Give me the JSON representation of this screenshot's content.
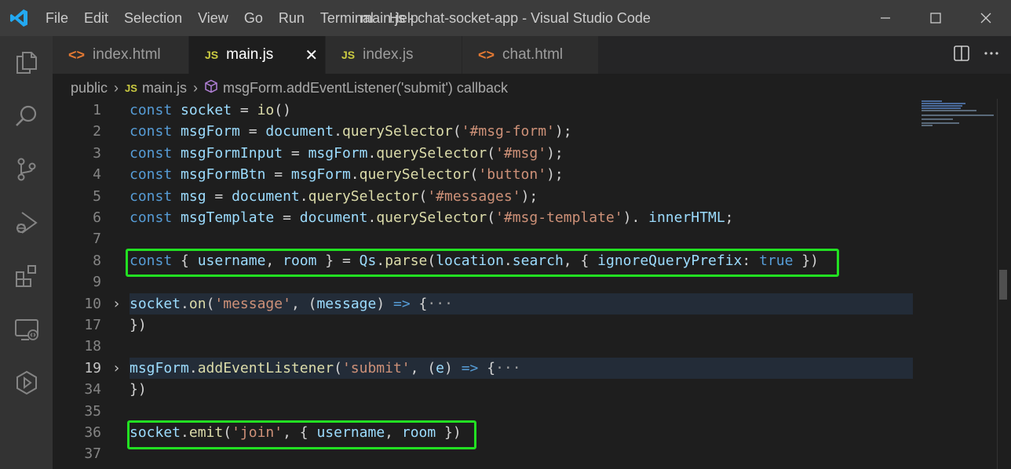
{
  "window": {
    "title": "main.js - chat-socket-app - Visual Studio Code",
    "menu": [
      "File",
      "Edit",
      "Selection",
      "View",
      "Go",
      "Run",
      "Terminal",
      "Help"
    ]
  },
  "activity_bar": [
    "explorer-icon",
    "search-icon",
    "source-control-icon",
    "run-debug-icon",
    "extensions-icon",
    "remote-explorer-icon",
    "live-share-icon"
  ],
  "tabs": [
    {
      "label": "index.html",
      "icon": "<>",
      "type": "html",
      "active": false
    },
    {
      "label": "main.js",
      "icon": "JS",
      "type": "js",
      "active": true,
      "close": "✕"
    },
    {
      "label": "index.js",
      "icon": "JS",
      "type": "js",
      "active": false
    },
    {
      "label": "chat.html",
      "icon": "<>",
      "type": "html",
      "active": false
    }
  ],
  "breadcrumb": {
    "folder": "public",
    "file_icon": "JS",
    "file": "main.js",
    "symbol": "msgForm.addEventListener('submit') callback"
  },
  "editor": {
    "lines": [
      {
        "n": "1",
        "tokens": [
          [
            "k",
            "const "
          ],
          [
            "v",
            "socket"
          ],
          [
            "p",
            " = "
          ],
          [
            "f",
            "io"
          ],
          [
            "p",
            "()"
          ]
        ]
      },
      {
        "n": "2",
        "tokens": [
          [
            "k",
            "const "
          ],
          [
            "v",
            "msgForm"
          ],
          [
            "p",
            " = "
          ],
          [
            "v",
            "document"
          ],
          [
            "p",
            "."
          ],
          [
            "f",
            "querySelector"
          ],
          [
            "p",
            "("
          ],
          [
            "s",
            "'#msg-form'"
          ],
          [
            "p",
            ");"
          ]
        ]
      },
      {
        "n": "3",
        "tokens": [
          [
            "k",
            "const "
          ],
          [
            "v",
            "msgFormInput"
          ],
          [
            "p",
            " = "
          ],
          [
            "v",
            "msgForm"
          ],
          [
            "p",
            "."
          ],
          [
            "f",
            "querySelector"
          ],
          [
            "p",
            "("
          ],
          [
            "s",
            "'#msg'"
          ],
          [
            "p",
            ");"
          ]
        ]
      },
      {
        "n": "4",
        "tokens": [
          [
            "k",
            "const "
          ],
          [
            "v",
            "msgFormBtn"
          ],
          [
            "p",
            " = "
          ],
          [
            "v",
            "msgForm"
          ],
          [
            "p",
            "."
          ],
          [
            "f",
            "querySelector"
          ],
          [
            "p",
            "("
          ],
          [
            "s",
            "'button'"
          ],
          [
            "p",
            ");"
          ]
        ]
      },
      {
        "n": "5",
        "tokens": [
          [
            "k",
            "const "
          ],
          [
            "v",
            "msg"
          ],
          [
            "p",
            " = "
          ],
          [
            "v",
            "document"
          ],
          [
            "p",
            "."
          ],
          [
            "f",
            "querySelector"
          ],
          [
            "p",
            "("
          ],
          [
            "s",
            "'#messages'"
          ],
          [
            "p",
            ");"
          ]
        ]
      },
      {
        "n": "6",
        "tokens": [
          [
            "k",
            "const "
          ],
          [
            "v",
            "msgTemplate"
          ],
          [
            "p",
            " = "
          ],
          [
            "v",
            "document"
          ],
          [
            "p",
            "."
          ],
          [
            "f",
            "querySelector"
          ],
          [
            "p",
            "("
          ],
          [
            "s",
            "'#msg-template'"
          ],
          [
            "p",
            "). "
          ],
          [
            "v",
            "innerHTML"
          ],
          [
            "p",
            ";"
          ]
        ]
      },
      {
        "n": "7",
        "tokens": []
      },
      {
        "n": "8",
        "tokens": [
          [
            "k",
            "const "
          ],
          [
            "p",
            "{ "
          ],
          [
            "v",
            "username"
          ],
          [
            "p",
            ", "
          ],
          [
            "v",
            "room"
          ],
          [
            "p",
            " } = "
          ],
          [
            "v",
            "Qs"
          ],
          [
            "p",
            "."
          ],
          [
            "f",
            "parse"
          ],
          [
            "p",
            "("
          ],
          [
            "v",
            "location"
          ],
          [
            "p",
            "."
          ],
          [
            "v",
            "search"
          ],
          [
            "p",
            ", { "
          ],
          [
            "v",
            "ignoreQueryPrefix"
          ],
          [
            "p",
            ": "
          ],
          [
            "k",
            "true"
          ],
          [
            "p",
            " })"
          ]
        ]
      },
      {
        "n": "9",
        "tokens": []
      },
      {
        "n": "10",
        "fold": true,
        "tokens": [
          [
            "v",
            "socket"
          ],
          [
            "p",
            "."
          ],
          [
            "f",
            "on"
          ],
          [
            "p",
            "("
          ],
          [
            "s",
            "'message'"
          ],
          [
            "p",
            ", ("
          ],
          [
            "v",
            "message"
          ],
          [
            "p",
            ") "
          ],
          [
            "k",
            "=>"
          ],
          [
            "p",
            " {"
          ],
          [
            "ell",
            "···"
          ]
        ]
      },
      {
        "n": "17",
        "tokens": [
          [
            "p",
            "})"
          ]
        ]
      },
      {
        "n": "18",
        "tokens": []
      },
      {
        "n": "19",
        "fold": true,
        "current": true,
        "tokens": [
          [
            "v",
            "msgForm"
          ],
          [
            "p",
            "."
          ],
          [
            "f",
            "addEventListener"
          ],
          [
            "p",
            "("
          ],
          [
            "s",
            "'submit'"
          ],
          [
            "p",
            ", ("
          ],
          [
            "v",
            "e"
          ],
          [
            "p",
            ") "
          ],
          [
            "k",
            "=>"
          ],
          [
            "p",
            " {"
          ],
          [
            "ell",
            "···"
          ]
        ]
      },
      {
        "n": "34",
        "tokens": [
          [
            "p",
            "})"
          ]
        ]
      },
      {
        "n": "35",
        "tokens": []
      },
      {
        "n": "36",
        "tokens": [
          [
            "v",
            "socket"
          ],
          [
            "p",
            "."
          ],
          [
            "f",
            "emit"
          ],
          [
            "p",
            "("
          ],
          [
            "s",
            "'join'"
          ],
          [
            "p",
            ", { "
          ],
          [
            "v",
            "username"
          ],
          [
            "p",
            ", "
          ],
          [
            "v",
            "room"
          ],
          [
            "p",
            " })"
          ]
        ]
      },
      {
        "n": "37",
        "tokens": []
      }
    ]
  }
}
